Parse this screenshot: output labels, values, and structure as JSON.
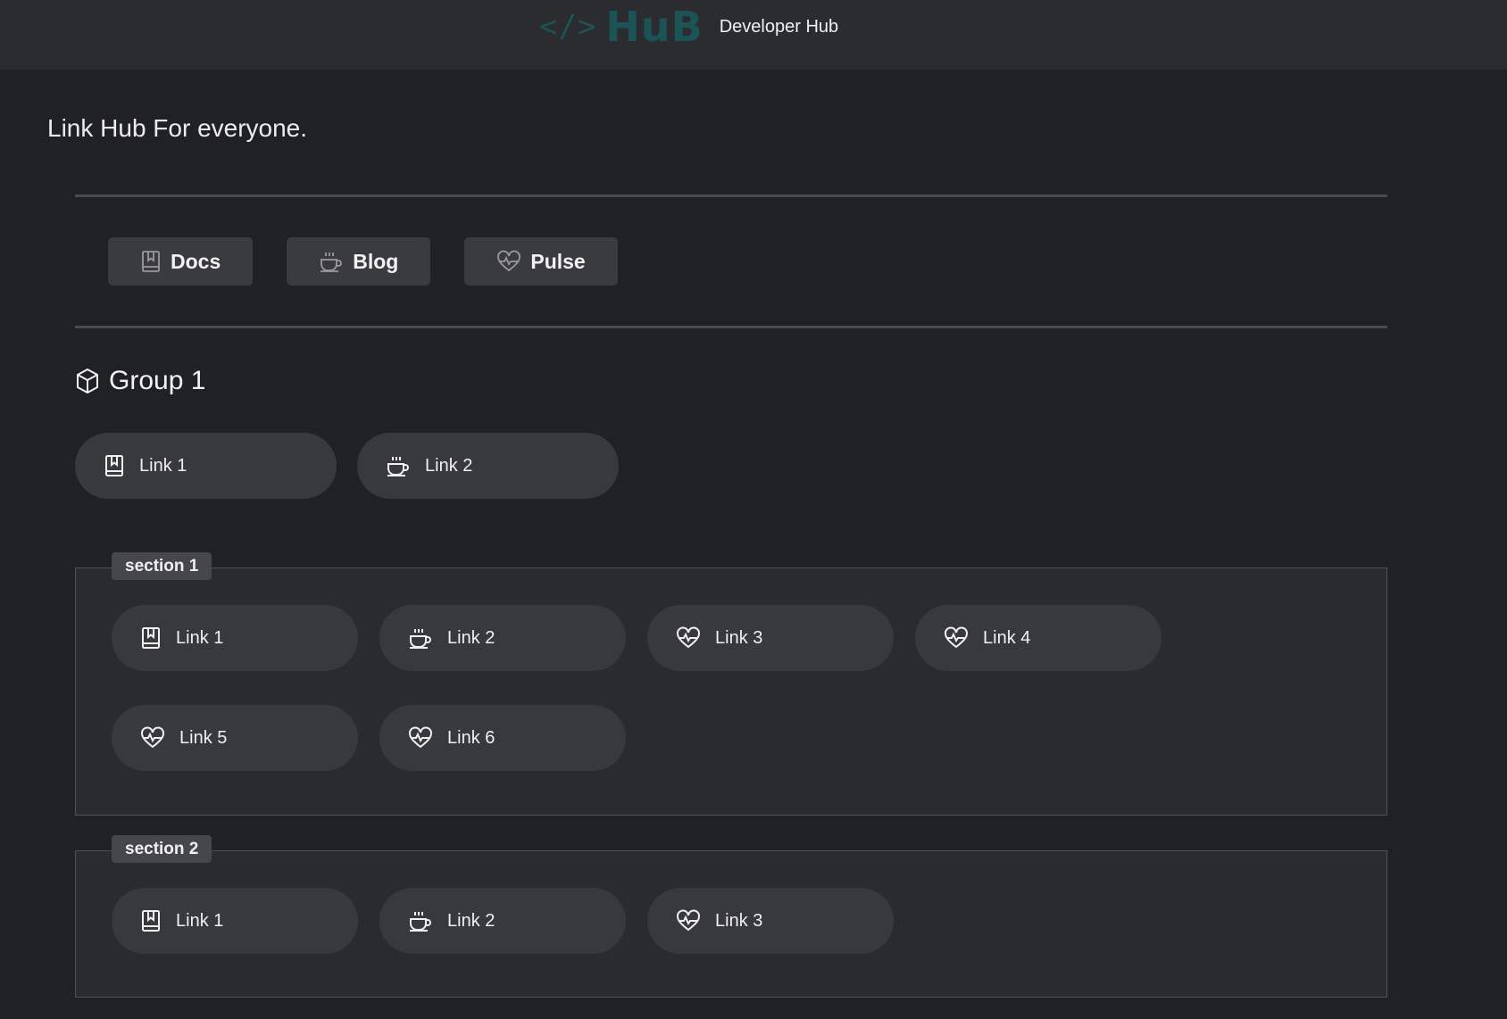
{
  "header": {
    "logo_code": "</>",
    "logo_word": "HuB",
    "title": "Developer Hub",
    "brand_color": "#1b5357"
  },
  "tagline": "Link Hub For everyone.",
  "quicknav": [
    {
      "label": "Docs",
      "icon": "book-icon"
    },
    {
      "label": "Blog",
      "icon": "coffee-cup-icon"
    },
    {
      "label": "Pulse",
      "icon": "heart-pulse-icon"
    }
  ],
  "group": {
    "title": "Group 1",
    "icon": "box-icon",
    "links": [
      {
        "label": "Link 1",
        "icon": "book-icon"
      },
      {
        "label": "Link 2",
        "icon": "coffee-cup-icon"
      }
    ]
  },
  "sections": [
    {
      "label": "section 1",
      "links": [
        {
          "label": "Link 1",
          "icon": "book-icon"
        },
        {
          "label": "Link 2",
          "icon": "coffee-cup-icon"
        },
        {
          "label": "Link 3",
          "icon": "heart-pulse-icon"
        },
        {
          "label": "Link 4",
          "icon": "heart-pulse-icon"
        },
        {
          "label": "Link 5",
          "icon": "heart-pulse-icon"
        },
        {
          "label": "Link 6",
          "icon": "heart-pulse-icon"
        }
      ]
    },
    {
      "label": "section 2",
      "links": [
        {
          "label": "Link 1",
          "icon": "book-icon"
        },
        {
          "label": "Link 2",
          "icon": "coffee-cup-icon"
        },
        {
          "label": "Link 3",
          "icon": "heart-pulse-icon"
        }
      ]
    }
  ]
}
